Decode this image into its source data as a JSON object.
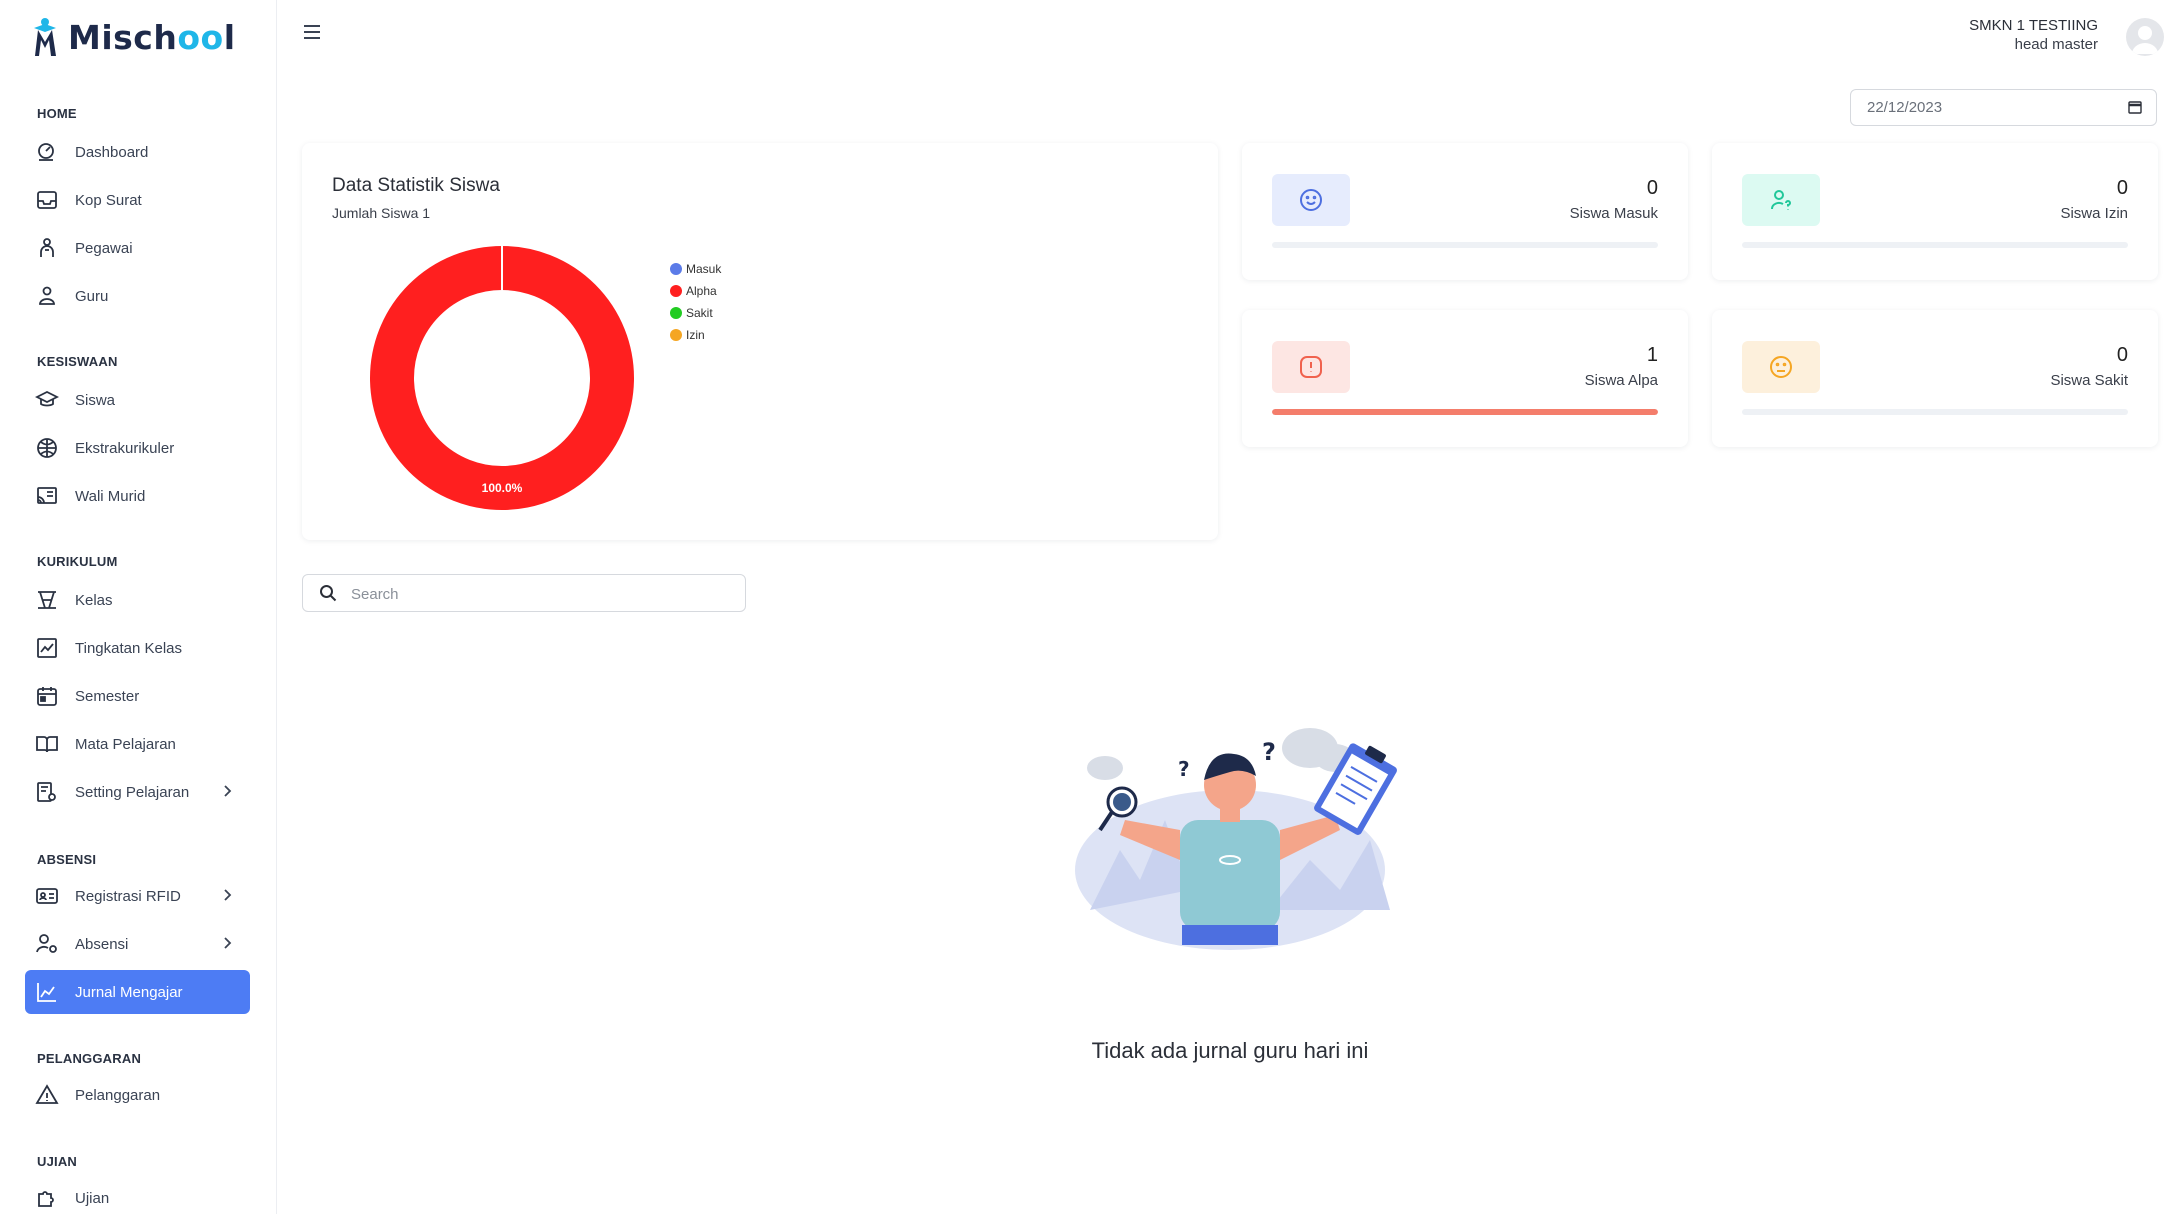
{
  "app": {
    "logo_text_a": "Misch",
    "logo_text_oo": "oo",
    "logo_text_b": "l"
  },
  "sidebar": {
    "sections": {
      "home": "HOME",
      "kesiswaan": "KESISWAAN",
      "kurikulum": "KURIKULUM",
      "absensi": "ABSENSI",
      "pelanggaran": "PELANGGARAN",
      "ujian": "UJIAN"
    },
    "items": {
      "dashboard": "Dashboard",
      "kop_surat": "Kop Surat",
      "pegawai": "Pegawai",
      "guru": "Guru",
      "siswa": "Siswa",
      "ekstrakurikuler": "Ekstrakurikuler",
      "wali_murid": "Wali Murid",
      "kelas": "Kelas",
      "tingkatan_kelas": "Tingkatan Kelas",
      "semester": "Semester",
      "mata_pelajaran": "Mata Pelajaran",
      "setting_pelajaran": "Setting Pelajaran",
      "registrasi_rfid": "Registrasi RFID",
      "absensi": "Absensi",
      "jurnal_mengajar": "Jurnal Mengajar",
      "pelanggaran": "Pelanggaran",
      "ujian": "Ujian"
    }
  },
  "header": {
    "school": "SMKN 1 TESTIING",
    "role": "head master",
    "date": "22/12/2023"
  },
  "chart_data": {
    "type": "pie",
    "title": "Data Statistik Siswa",
    "subtitle": "Jumlah Siswa 1",
    "categories": [
      "Masuk",
      "Alpha",
      "Sakit",
      "Izin"
    ],
    "values": [
      0,
      1,
      0,
      0
    ],
    "colors": [
      "#5b7be8",
      "#ff1f1f",
      "#22cc22",
      "#f5a623"
    ],
    "data_labels": [
      "",
      "100.0%",
      "",
      ""
    ],
    "legend_position": "right"
  },
  "stats": {
    "masuk": {
      "value": "0",
      "label": "Siswa Masuk",
      "level": 0,
      "icon": "smile-icon",
      "icon_bg": "#e6ecfd",
      "icon_color": "#4d6fe0"
    },
    "izin": {
      "value": "0",
      "label": "Siswa Izin",
      "level": 0,
      "icon": "user-question-icon",
      "icon_bg": "#dcfaf2",
      "icon_color": "#20c79a"
    },
    "alpa": {
      "value": "1",
      "label": "Siswa Alpa",
      "level": 1,
      "icon": "alert-icon",
      "icon_bg": "#fde6e3",
      "icon_color": "#f0624e"
    },
    "sakit": {
      "value": "0",
      "label": "Siswa Sakit",
      "level": 0,
      "icon": "sad-face-icon",
      "icon_bg": "#fdf0dc",
      "icon_color": "#f5a623"
    }
  },
  "search": {
    "placeholder": "Search"
  },
  "empty_state": {
    "text": "Tidak ada jurnal guru hari ini"
  }
}
